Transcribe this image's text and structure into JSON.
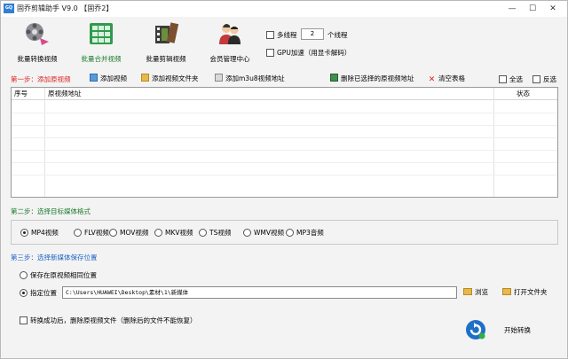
{
  "window": {
    "title": "固乔剪辑助手 V9.0 【固乔2】",
    "icon_text": "GQ",
    "minimize": "—",
    "maximize": "☐",
    "close": "✕"
  },
  "toolbar": {
    "items": [
      {
        "label": "批量转换视频",
        "icon": "film-reel-icon",
        "active": false
      },
      {
        "label": "批量合并视频",
        "icon": "merge-grid-icon",
        "active": true
      },
      {
        "label": "批量剪辑视频",
        "icon": "clapper-icon",
        "active": false
      },
      {
        "label": "会员管理中心",
        "icon": "members-icon",
        "active": false
      }
    ],
    "multithread_label": "多线程",
    "thread_count": "2",
    "thread_unit": "个线程",
    "gpu_label": "GPU加速（用显卡解码）"
  },
  "step1": {
    "title": "第一步：添加原视频",
    "actions": [
      {
        "label": "添加视频",
        "icon": "add-video-icon"
      },
      {
        "label": "添加视频文件夹",
        "icon": "add-folder-icon"
      },
      {
        "label": "添加m3u8视频地址",
        "icon": "add-link-icon"
      },
      {
        "label": "删除已选择的原视频地址",
        "icon": "delete-selected-icon"
      },
      {
        "label": "清空表格",
        "icon": "clear-icon"
      },
      {
        "label": "全选",
        "icon": ""
      },
      {
        "label": "反选",
        "icon": ""
      }
    ],
    "table": {
      "columns": [
        "序号",
        "原视频地址",
        "状态"
      ],
      "rows": []
    }
  },
  "step2": {
    "title": "第二步：选择目标媒体格式",
    "formats": [
      "MP4视频",
      "FLV视频",
      "MOV视频",
      "MKV视频",
      "TS视频",
      "WMV视频",
      "MP3音频"
    ],
    "selected": "MP4视频"
  },
  "step3": {
    "title": "第三步：选择新媒体保存位置",
    "option_same": "保存在原视频相同位置",
    "option_custom": "指定位置",
    "path": "C:\\Users\\HUAWEI\\Desktop\\素材\\1\\新媒体",
    "browse": "浏览",
    "open_folder": "打开文件夹"
  },
  "footer": {
    "delete_after_label": "转换成功后，删除原视频文件（删除后的文件不能恢复）",
    "start": "开始转换"
  },
  "colors": {
    "step1": "#dd2222",
    "step2": "#1a7a2a",
    "step3": "#1d63c4"
  }
}
